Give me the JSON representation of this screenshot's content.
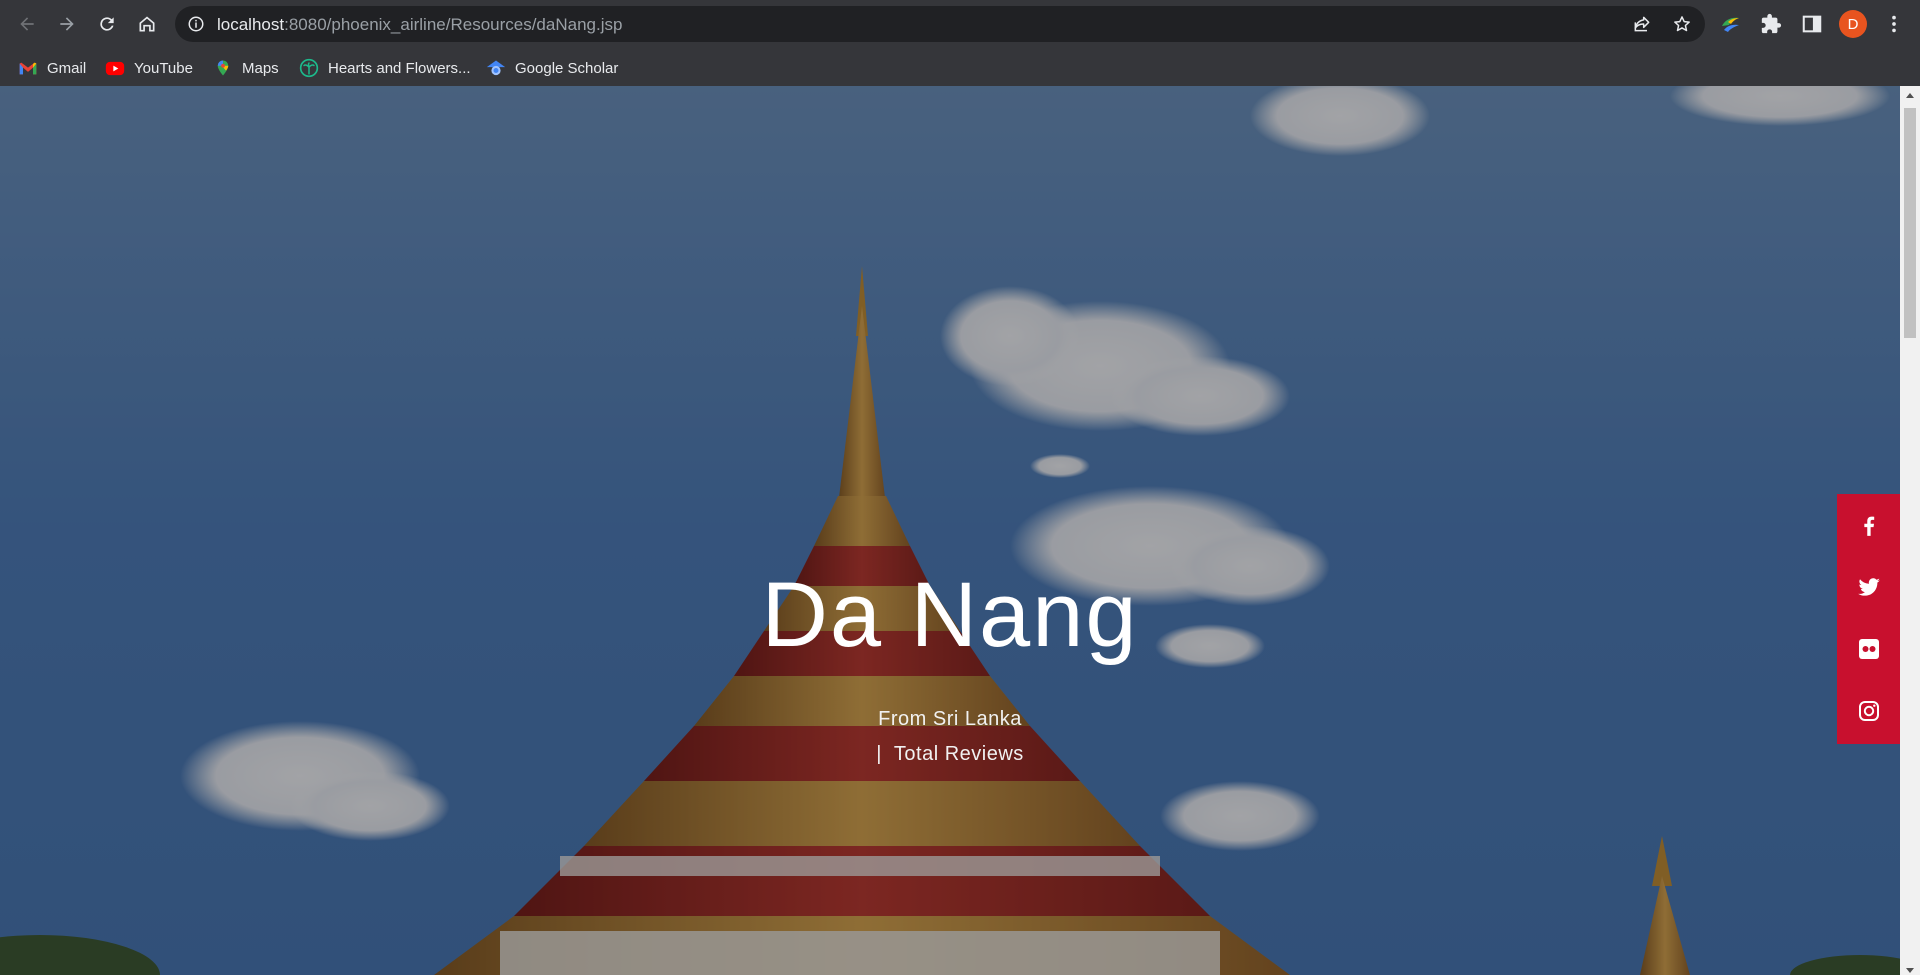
{
  "browser": {
    "url_host": "localhost",
    "url_rest": ":8080/phoenix_airline/Resources/daNang.jsp",
    "avatar_letter": "D",
    "icons": [
      "back-icon",
      "forward-icon",
      "reload-icon",
      "home-icon",
      "info-icon",
      "share-icon",
      "star-icon",
      "extension-icon",
      "puzzle-icon",
      "sidebar-icon",
      "menu-icon"
    ]
  },
  "bookmarks": [
    {
      "label": "Gmail",
      "icon": "gmail-icon"
    },
    {
      "label": "YouTube",
      "icon": "youtube-icon"
    },
    {
      "label": "Maps",
      "icon": "maps-icon"
    },
    {
      "label": "Hearts and Flowers...",
      "icon": "palm-icon"
    },
    {
      "label": "Google Scholar",
      "icon": "scholar-icon"
    }
  ],
  "hero": {
    "title": "Da Nang",
    "subtitle": "From Sri Lanka",
    "reviews_separator": "|",
    "reviews_label": "Total Reviews"
  },
  "social": {
    "accent": "#c8102e",
    "items": [
      "facebook-icon",
      "twitter-icon",
      "flickr-icon",
      "instagram-icon"
    ]
  }
}
